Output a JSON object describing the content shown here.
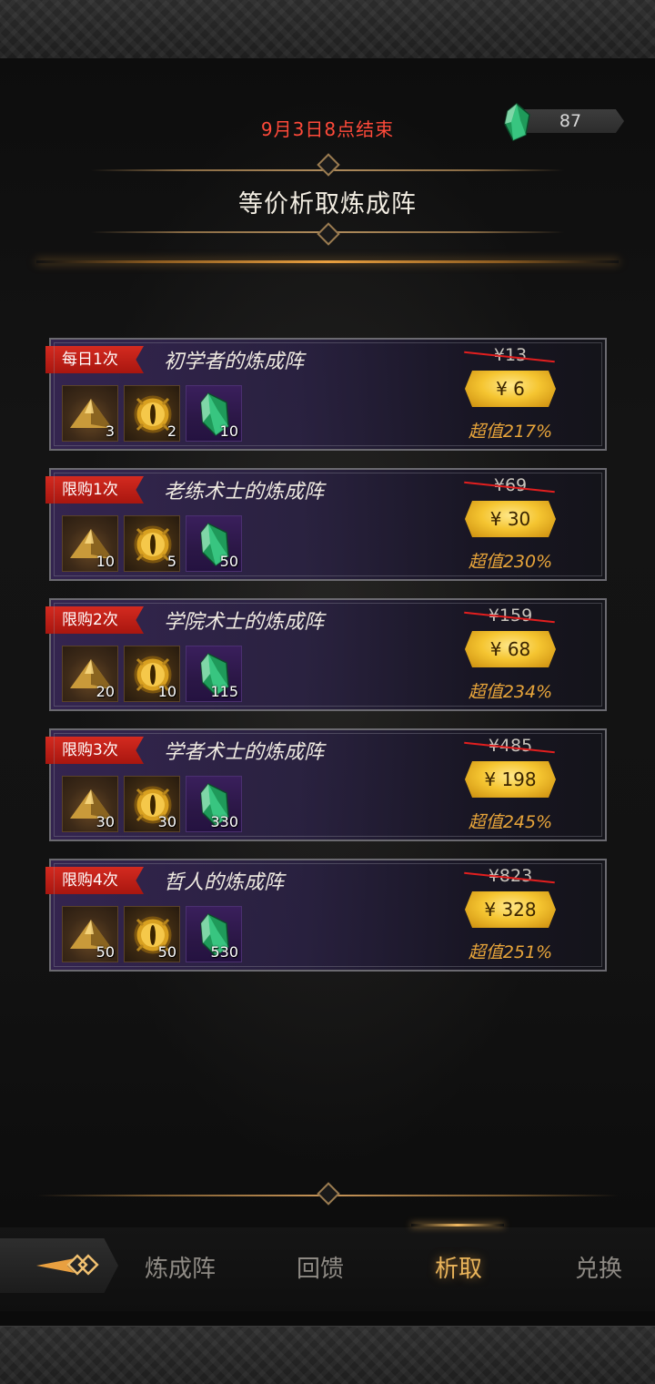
{
  "header": {
    "end_time": "9月3日8点结束",
    "currency_value": "87",
    "title": "等价析取炼成阵"
  },
  "offers": [
    {
      "tag": "每日1次",
      "title": "初学者的炼成阵",
      "items": [
        {
          "icon": "golden-pyramid-icon",
          "count": "3"
        },
        {
          "icon": "golden-eye-orb-icon",
          "count": "2"
        },
        {
          "icon": "green-gem-icon",
          "count": "10"
        }
      ],
      "original_price": "¥13",
      "price": "¥ 6",
      "value": "超值217%"
    },
    {
      "tag": "限购1次",
      "title": "老练术士的炼成阵",
      "items": [
        {
          "icon": "golden-pyramid-icon",
          "count": "10"
        },
        {
          "icon": "golden-eye-orb-icon",
          "count": "5"
        },
        {
          "icon": "green-gem-icon",
          "count": "50"
        }
      ],
      "original_price": "¥69",
      "price": "¥ 30",
      "value": "超值230%"
    },
    {
      "tag": "限购2次",
      "title": "学院术士的炼成阵",
      "items": [
        {
          "icon": "golden-pyramid-icon",
          "count": "20"
        },
        {
          "icon": "golden-eye-orb-icon",
          "count": "10"
        },
        {
          "icon": "green-gem-icon",
          "count": "115"
        }
      ],
      "original_price": "¥159",
      "price": "¥ 68",
      "value": "超值234%"
    },
    {
      "tag": "限购3次",
      "title": "学者术士的炼成阵",
      "items": [
        {
          "icon": "golden-pyramid-icon",
          "count": "30"
        },
        {
          "icon": "golden-eye-orb-icon",
          "count": "30"
        },
        {
          "icon": "green-gem-icon",
          "count": "330"
        }
      ],
      "original_price": "¥485",
      "price": "¥ 198",
      "value": "超值245%"
    },
    {
      "tag": "限购4次",
      "title": "哲人的炼成阵",
      "items": [
        {
          "icon": "golden-pyramid-icon",
          "count": "50"
        },
        {
          "icon": "golden-eye-orb-icon",
          "count": "50"
        },
        {
          "icon": "green-gem-icon",
          "count": "530"
        }
      ],
      "original_price": "¥823",
      "price": "¥ 328",
      "value": "超值251%"
    }
  ],
  "nav": {
    "tabs": [
      {
        "label": "炼成阵",
        "active": false
      },
      {
        "label": "回馈",
        "active": false
      },
      {
        "label": "析取",
        "active": true
      },
      {
        "label": "兑换",
        "active": false
      }
    ]
  },
  "colors": {
    "end_time_red": "#ff4a3a",
    "tag_red": "#d42a20",
    "price_gold": "#f5c531",
    "value_orange": "#e8a53a",
    "active_tab": "#e9b45a"
  }
}
